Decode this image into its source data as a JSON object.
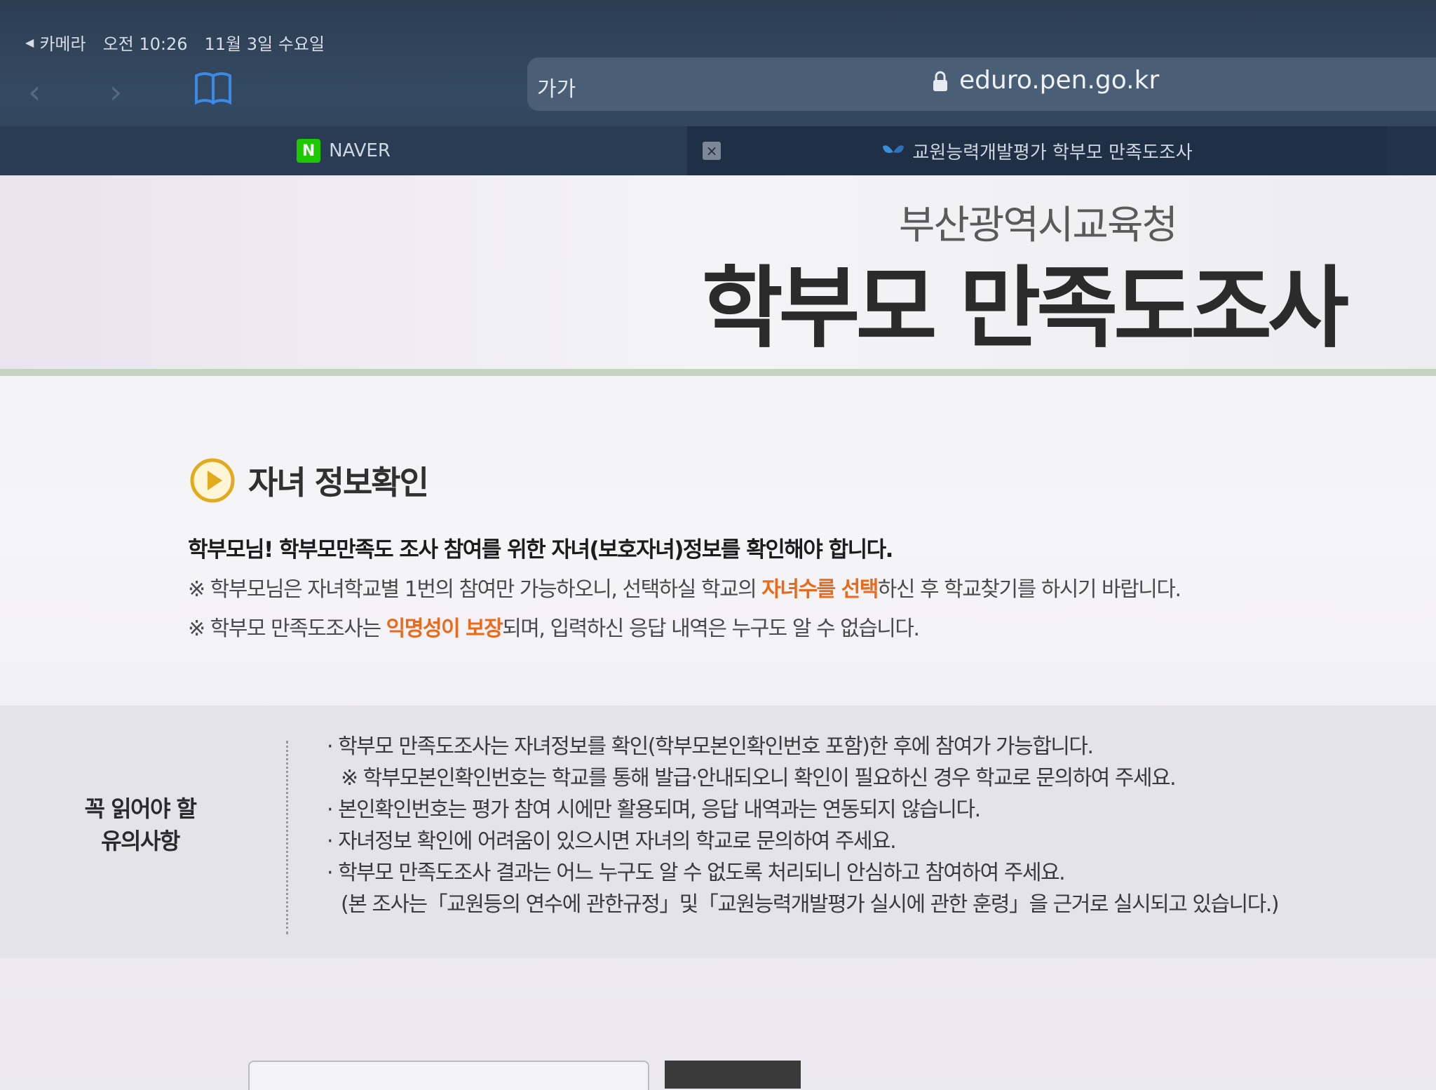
{
  "status_bar": {
    "back_app": "카메라",
    "time": "오전 10:26",
    "date": "11월 3일 수요일"
  },
  "browser": {
    "text_size_button": "가가",
    "url": "eduro.pen.go.kr",
    "tabs": [
      {
        "label": "NAVER",
        "logo_letter": "N"
      },
      {
        "label": "교원능력개발평가 학부모 만족도조사"
      }
    ],
    "close_glyph": "×"
  },
  "header": {
    "org_name": "부산광역시교육청",
    "title": "학부모 만족도조사"
  },
  "section": {
    "title": "자녀 정보확인",
    "lead": "학부모님! 학부모만족도 조사 참여를 위한 자녀(보호자녀)정보를 확인해야 합니다.",
    "note1_before": "※ 학부모님은 자녀학교별 1번의 참여만 가능하오니, 선택하실 학교의 ",
    "note1_highlight": "자녀수를 선택",
    "note1_after": "하신 후 학교찾기를 하시기 바랍니다.",
    "note2_before": "※ 학부모 만족도조사는 ",
    "note2_highlight": "익명성이 보장",
    "note2_after": "되며, 입력하신 응답 내역은 누구도 알 수 없습니다.",
    "highlight_color": "#e86a1a"
  },
  "notice": {
    "label_line1": "꼭 읽어야 할",
    "label_line2": "유의사항",
    "items": [
      "· 학부모 만족도조사는 자녀정보를 확인(학부모본인확인번호 포함)한 후에 참여가 가능합니다.",
      "※ 학부모본인확인번호는 학교를 통해 발급·안내되오니 확인이 필요하신 경우 학교로 문의하여 주세요.",
      "· 본인확인번호는 평가 참여 시에만 활용되며, 응답 내역과는 연동되지 않습니다.",
      "· 자녀정보 확인에 어려움이 있으시면 자녀의 학교로 문의하여 주세요.",
      "· 학부모 만족도조사 결과는 어느 누구도 알 수 없도록 처리되니 안심하고 참여하여 주세요.",
      "(본 조사는「교원등의 연수에 관한규정」및「교원능력개발평가 실시에 관한 훈령」을 근거로 실시되고 있습니다.)"
    ]
  },
  "icons": {
    "back": "chevron-left-icon",
    "forward": "chevron-right-icon",
    "bookmarks": "book-icon",
    "lock": "lock-icon",
    "play": "play-circle-icon"
  }
}
